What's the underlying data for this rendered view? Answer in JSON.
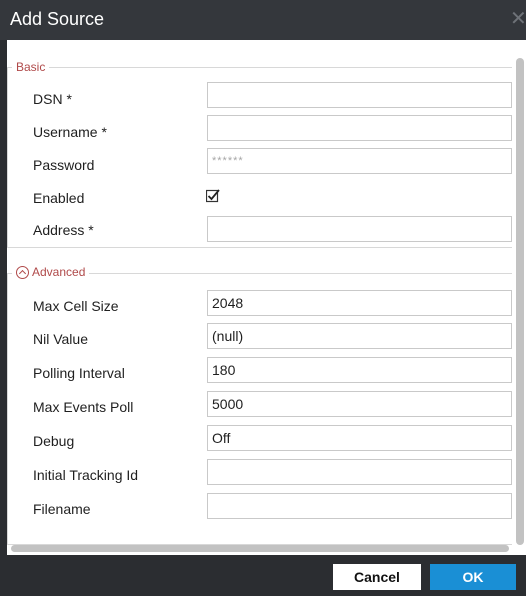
{
  "dialog": {
    "title": "Add Source",
    "close_icon": "close-icon"
  },
  "basic": {
    "legend": "Basic",
    "dsn_label": "DSN *",
    "dsn_value": "",
    "username_label": "Username *",
    "username_value": "",
    "password_label": "Password",
    "password_value": "******",
    "enabled_label": "Enabled",
    "enabled_checked": true,
    "address_label": "Address *",
    "address_value": ""
  },
  "advanced": {
    "legend": "Advanced",
    "toggle_icon": "chevron-up-circle-icon",
    "max_cell_size_label": "Max Cell Size",
    "max_cell_size_value": "2048",
    "nil_value_label": "Nil Value",
    "nil_value_value": "(null)",
    "polling_interval_label": "Polling Interval",
    "polling_interval_value": "180",
    "max_events_poll_label": "Max Events Poll",
    "max_events_poll_value": "5000",
    "debug_label": "Debug",
    "debug_value": "Off",
    "initial_tracking_id_label": "Initial Tracking Id",
    "initial_tracking_id_value": "",
    "filename_label": "Filename",
    "filename_value": ""
  },
  "footer": {
    "cancel_label": "Cancel",
    "ok_label": "OK"
  },
  "colors": {
    "titlebar": "#34373c",
    "legend_text": "#b04a4a",
    "ok_button": "#1a8fd5",
    "footer": "#2b2d31"
  }
}
